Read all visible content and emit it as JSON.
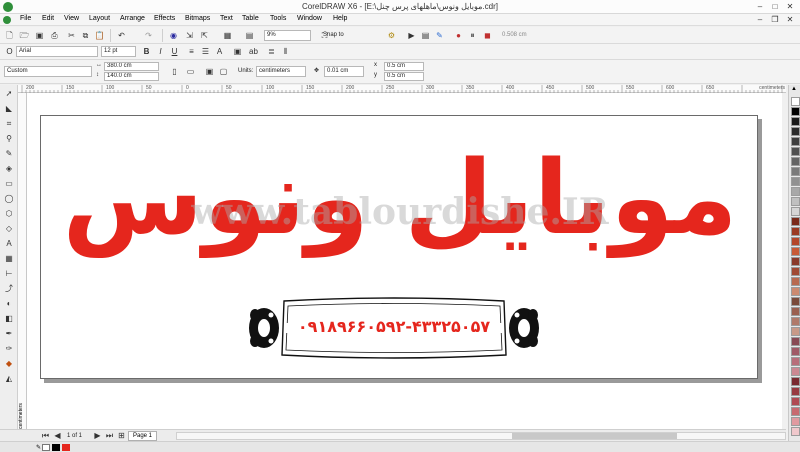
{
  "window": {
    "title": "CorelDRAW X6 - [E:\\موبایل ونوس\\ماهلهای پرس چنل.cdr]",
    "minimize": "–",
    "maximize": "□",
    "close": "✕"
  },
  "menu": [
    "File",
    "Edit",
    "View",
    "Layout",
    "Arrange",
    "Effects",
    "Bitmaps",
    "Text",
    "Table",
    "Tools",
    "Window",
    "Help"
  ],
  "toolbar": {
    "zoom": "9%",
    "snap_to": "Snap to",
    "offset": "0.508 cm"
  },
  "font_bar": {
    "font": "Arial",
    "size": "12 pt"
  },
  "property_bar": {
    "preset": "Custom",
    "width": "380.0 cm",
    "height": "140.0 cm",
    "units_label": "Units:",
    "units": "centimeters",
    "nudge": "0.01 cm",
    "dup_x": "0.5 cm",
    "dup_y": "0.5 cm"
  },
  "ruler": {
    "unit": "centimeters",
    "labels": [
      "200",
      "150",
      "100",
      "50",
      "0",
      "50",
      "100",
      "150",
      "200",
      "250",
      "300",
      "350",
      "400",
      "450",
      "500",
      "550",
      "600",
      "650"
    ]
  },
  "design": {
    "headline": "موبایل ونوس",
    "watermark": "www.tablourdishe.IR",
    "phone": "۰۹۱۸۹۶۶۰۵۹۲-۴۳۳۲۵۰۵۷",
    "headline_color": "#e5261d"
  },
  "status": {
    "page_count": "1 of 1",
    "page_tab": "Page 1"
  },
  "palette_colors": [
    "#ffffff",
    "#000000",
    "#1a1a1a",
    "#2b2b2b",
    "#3d3d3d",
    "#4f4f4f",
    "#646464",
    "#7a7a7a",
    "#919191",
    "#a8a8a8",
    "#c0c0c0",
    "#d6d6d6",
    "#7a2a1a",
    "#9b3a22",
    "#b4472a",
    "#c85a36",
    "#8a3a2a",
    "#a04a34",
    "#b86a50",
    "#cc8a70",
    "#7a4a3a",
    "#9a6050",
    "#b07a6a",
    "#c89a88",
    "#884a54",
    "#a05a66",
    "#b86e7a",
    "#cc8892",
    "#7a2a30",
    "#983a40",
    "#b04a52",
    "#c86a70",
    "#e09aa0",
    "#f0c8cc"
  ]
}
